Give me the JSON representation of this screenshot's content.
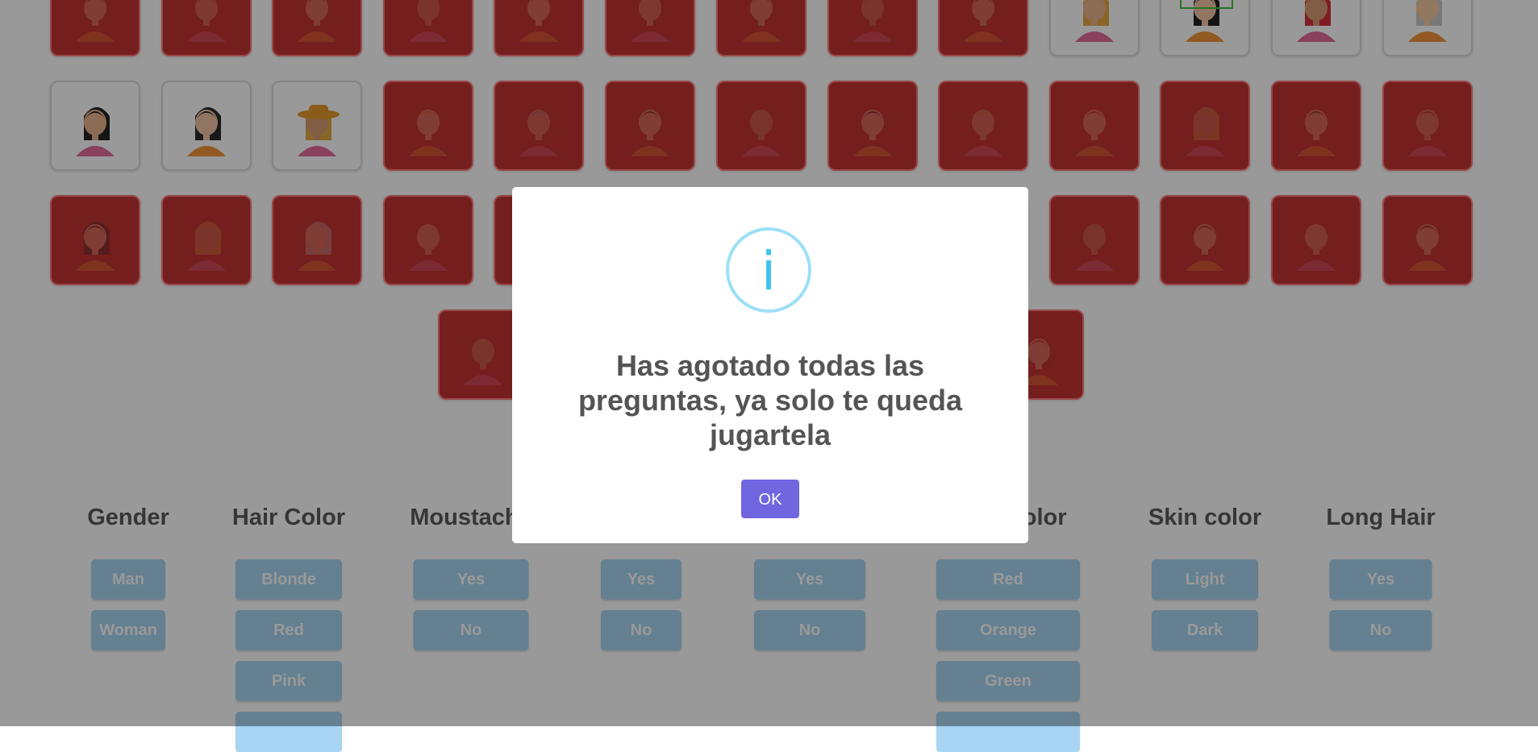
{
  "board": {
    "rows": [
      [
        {
          "character": "man-dark-hair",
          "eliminated": true
        },
        {
          "character": "man-light-hair",
          "eliminated": true
        },
        {
          "character": "man-bald",
          "eliminated": true
        },
        {
          "character": "man-tie",
          "eliminated": true
        },
        {
          "character": "man-shirt",
          "eliminated": true
        },
        {
          "character": "man-grey",
          "eliminated": true
        },
        {
          "character": "man-vest",
          "eliminated": true
        },
        {
          "character": "man-short-hair",
          "eliminated": true
        },
        {
          "character": "man-beard",
          "eliminated": true
        },
        {
          "character": "woman-blonde",
          "eliminated": false
        },
        {
          "character": "woman-black-hair",
          "eliminated": false,
          "selected": true
        },
        {
          "character": "woman-red-hair",
          "eliminated": false
        },
        {
          "character": "woman-grey-hair",
          "eliminated": false
        }
      ],
      [
        {
          "character": "woman-black-ponytail",
          "eliminated": false
        },
        {
          "character": "woman-brown-hair",
          "eliminated": false
        },
        {
          "character": "woman-hat",
          "eliminated": false
        },
        {
          "character": "man-blonde",
          "eliminated": true
        },
        {
          "character": "man-brown-hair",
          "eliminated": true
        },
        {
          "character": "man-red-shirt",
          "eliminated": true
        },
        {
          "character": "man-blonde-vest",
          "eliminated": true
        },
        {
          "character": "man-moustache",
          "eliminated": true
        },
        {
          "character": "man-dark-skin",
          "eliminated": true
        },
        {
          "character": "man-orange-shirt",
          "eliminated": true
        },
        {
          "character": "woman-blonde-long",
          "eliminated": true
        },
        {
          "character": "man-suit",
          "eliminated": true
        },
        {
          "character": "man-suit-red",
          "eliminated": true
        }
      ],
      [
        {
          "character": "woman-curly",
          "eliminated": true
        },
        {
          "character": "woman-curly-orange",
          "eliminated": true
        },
        {
          "character": "woman-curly-grey",
          "eliminated": true
        },
        {
          "character": "man-blonde-orange",
          "eliminated": true
        },
        {
          "character": "man-hidden-1",
          "eliminated": true
        },
        {
          "character": "man-hidden-2",
          "eliminated": true
        },
        {
          "character": "man-hidden-3",
          "eliminated": true
        },
        {
          "character": "man-hidden-4",
          "eliminated": true
        },
        {
          "character": "man-hidden-5",
          "eliminated": true
        },
        {
          "character": "man-red-tie",
          "eliminated": true
        },
        {
          "character": "man-cap",
          "eliminated": true
        },
        {
          "character": "man-blonde-dark",
          "eliminated": true
        },
        {
          "character": "man-moustache-green",
          "eliminated": true
        }
      ],
      [
        {
          "character": "man-red-shirt-2",
          "eliminated": true
        },
        {
          "character": "woman-hidden",
          "eliminated": true
        }
      ]
    ]
  },
  "questions": [
    {
      "title": "Gender",
      "options": [
        "Man",
        "Woman"
      ]
    },
    {
      "title": "Hair Color",
      "options": [
        "Blonde",
        "Red",
        "Pink",
        ""
      ]
    },
    {
      "title": "Moustache",
      "options": [
        "Yes",
        "No"
      ]
    },
    {
      "title": "",
      "options": [
        "Yes",
        "No"
      ]
    },
    {
      "title": "",
      "options": [
        "Yes",
        "No"
      ]
    },
    {
      "title": "Shirt color",
      "options": [
        "Red",
        "Orange",
        "Green",
        ""
      ]
    },
    {
      "title": "Skin color",
      "options": [
        "Light",
        "Dark"
      ]
    },
    {
      "title": "Long Hair",
      "options": [
        "Yes",
        "No"
      ]
    }
  ],
  "modal": {
    "icon": "info-icon",
    "icon_glyph": "i",
    "message": "Has agotado todas las preguntas, ya solo te queda jugartela",
    "ok_label": "OK"
  },
  "colors": {
    "eliminated": "#c43333",
    "ok_button": "#7066e0",
    "info_icon": "#3fc3ee",
    "question_button": "#a7d5f2"
  }
}
